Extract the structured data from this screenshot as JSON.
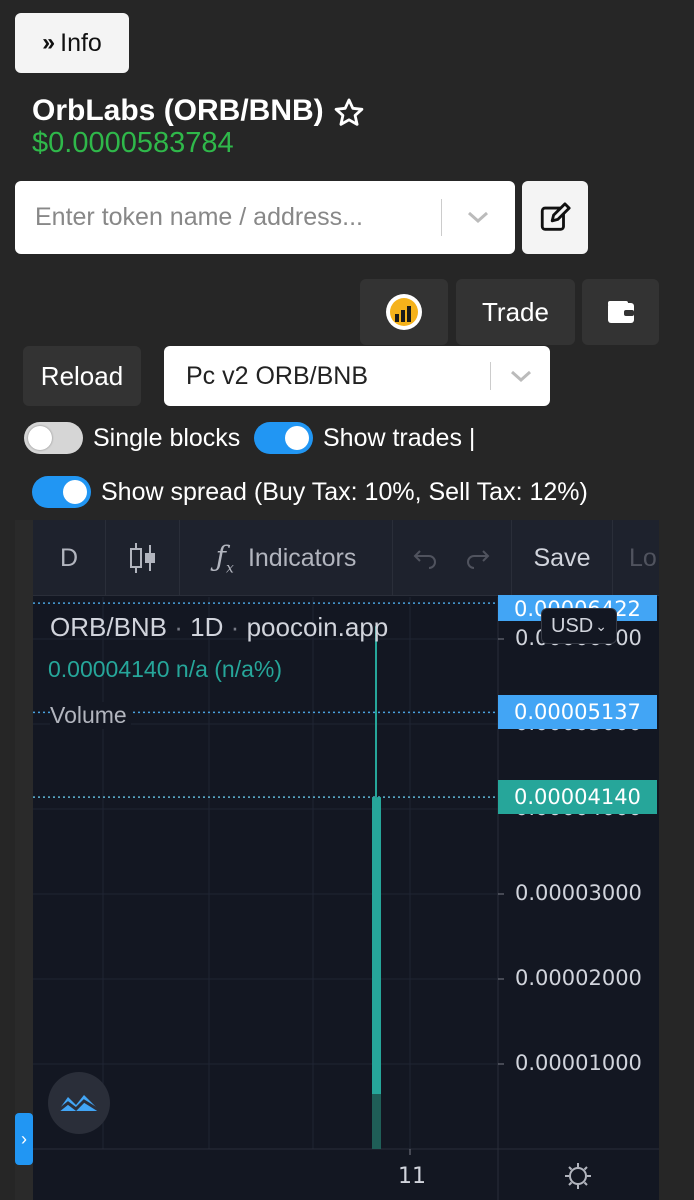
{
  "info_button": {
    "label": "Info",
    "icon": "double-chevron-right-icon"
  },
  "token": {
    "title": "OrbLabs (ORB/BNB)",
    "price": "$0.0000583784",
    "favorite_icon": "star-outline-icon"
  },
  "search": {
    "placeholder": "Enter token name / address...",
    "value": "",
    "dropdown_icon": "chevron-down-icon",
    "edit_icon": "edit-icon"
  },
  "actions": {
    "logo_icon": "poocoin-logo-icon",
    "trade_label": "Trade",
    "wallet_icon": "wallet-icon"
  },
  "reload_label": "Reload",
  "pair_select": {
    "value": "Pc v2 ORB/BNB"
  },
  "toggles": {
    "single_blocks": {
      "label": "Single blocks",
      "on": false
    },
    "show_trades": {
      "label": "Show trades |",
      "on": true
    },
    "show_spread": {
      "label": "Show spread (Buy Tax: 10%, Sell Tax: 12%)",
      "on": true
    }
  },
  "chart_toolbar": {
    "interval": "D",
    "indicators": "Indicators",
    "save": "Save",
    "truncated": "Lo"
  },
  "chart_legend": {
    "symbol": "ORB/BNB",
    "sep1": "·",
    "interval": "1D",
    "sep2": "·",
    "source": "poocoin.app",
    "ohlc_value": "0.00004140",
    "ohlc_change": "n/a (n/a%)",
    "volume_label": "Volume"
  },
  "price_axis": {
    "currency": "USD",
    "tags": [
      {
        "label": "0.00006422",
        "color": "#42a5f5"
      },
      {
        "label": "0.00005137",
        "color": "#42a5f5"
      },
      {
        "label": "0.00004140",
        "color": "#26a69a"
      }
    ],
    "ticks": [
      "0.00006000",
      "0.00005000",
      "0.00004000",
      "0.00003000",
      "0.00002000",
      "0.00001000"
    ]
  },
  "time_axis": {
    "labels": [
      "11"
    ]
  },
  "chart_data": {
    "type": "candlestick",
    "symbol": "ORB/BNB",
    "interval": "1D",
    "x": [
      "11"
    ],
    "series": [
      {
        "open": 1e-06,
        "high": 6.422e-05,
        "low": 1e-06,
        "close": 4.14e-05
      }
    ],
    "ylim": [
      0.0,
      6.8e-05
    ],
    "yticks": [
      1e-05,
      2e-05,
      3e-05,
      4e-05,
      5e-05,
      6e-05
    ],
    "price_lines": [
      6.422e-05,
      5.137e-05,
      4.14e-05
    ],
    "grid": true,
    "colors": {
      "up": "#26a69a",
      "line_blue": "#42a5f5"
    }
  }
}
